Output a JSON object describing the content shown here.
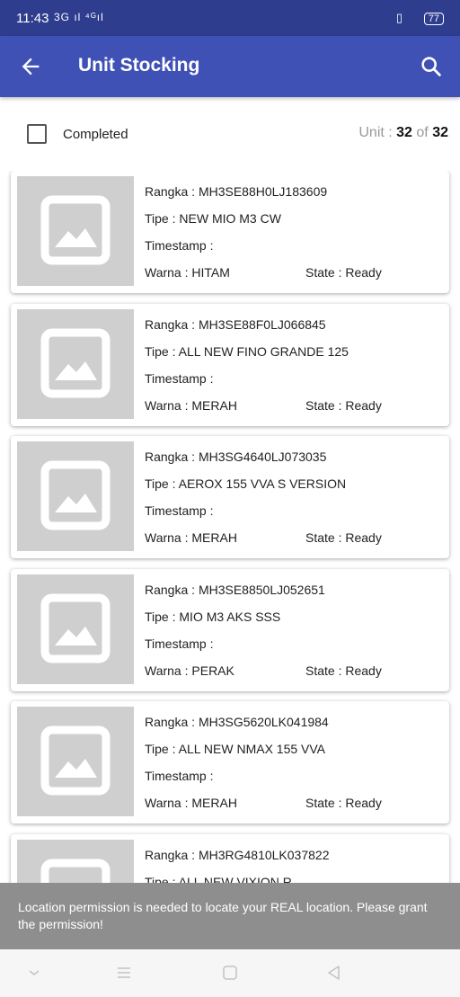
{
  "status_bar": {
    "time": "11:43",
    "signal": "3G ıl ⁴ᴳıl",
    "battery": "77"
  },
  "app_bar": {
    "title": "Unit Stocking",
    "back_icon": "arrow-left-icon",
    "search_icon": "search-icon",
    "color": "#3f51b5"
  },
  "filter": {
    "completed_label": "Completed",
    "completed_checked": false,
    "unit_label": "Unit",
    "unit_current": "32",
    "unit_of": "of",
    "unit_total": "32"
  },
  "labels": {
    "rangka": "Rangka : ",
    "tipe": "Tipe : ",
    "timestamp": "Timestamp : ",
    "warna": "Warna : ",
    "state": "State : "
  },
  "units": [
    {
      "rangka": "MH3SE88H0LJ183609",
      "tipe": "NEW MIO M3 CW",
      "timestamp": "",
      "warna": "HITAM",
      "state": "Ready"
    },
    {
      "rangka": "MH3SE88F0LJ066845",
      "tipe": "ALL NEW FINO GRANDE 125",
      "timestamp": "",
      "warna": "MERAH",
      "state": "Ready"
    },
    {
      "rangka": "MH3SG4640LJ073035",
      "tipe": "AEROX 155 VVA S VERSION",
      "timestamp": "",
      "warna": "MERAH",
      "state": "Ready"
    },
    {
      "rangka": "MH3SE8850LJ052651",
      "tipe": "MIO M3 AKS SSS",
      "timestamp": "",
      "warna": "PERAK",
      "state": "Ready"
    },
    {
      "rangka": "MH3SG5620LK041984",
      "tipe": "ALL NEW NMAX 155 VVA",
      "timestamp": "",
      "warna": "MERAH",
      "state": "Ready"
    },
    {
      "rangka": "MH3RG4810LK037822",
      "tipe": "ALL NEW VIXION R",
      "timestamp": "",
      "warna": "",
      "state": ""
    }
  ],
  "snackbar": {
    "message": "Location permission is needed to locate your REAL location. Please grant the permission!"
  },
  "nav_bar": {
    "icons": [
      "chevron-down-icon",
      "menu-icon",
      "home-square-icon",
      "back-triangle-icon"
    ]
  }
}
